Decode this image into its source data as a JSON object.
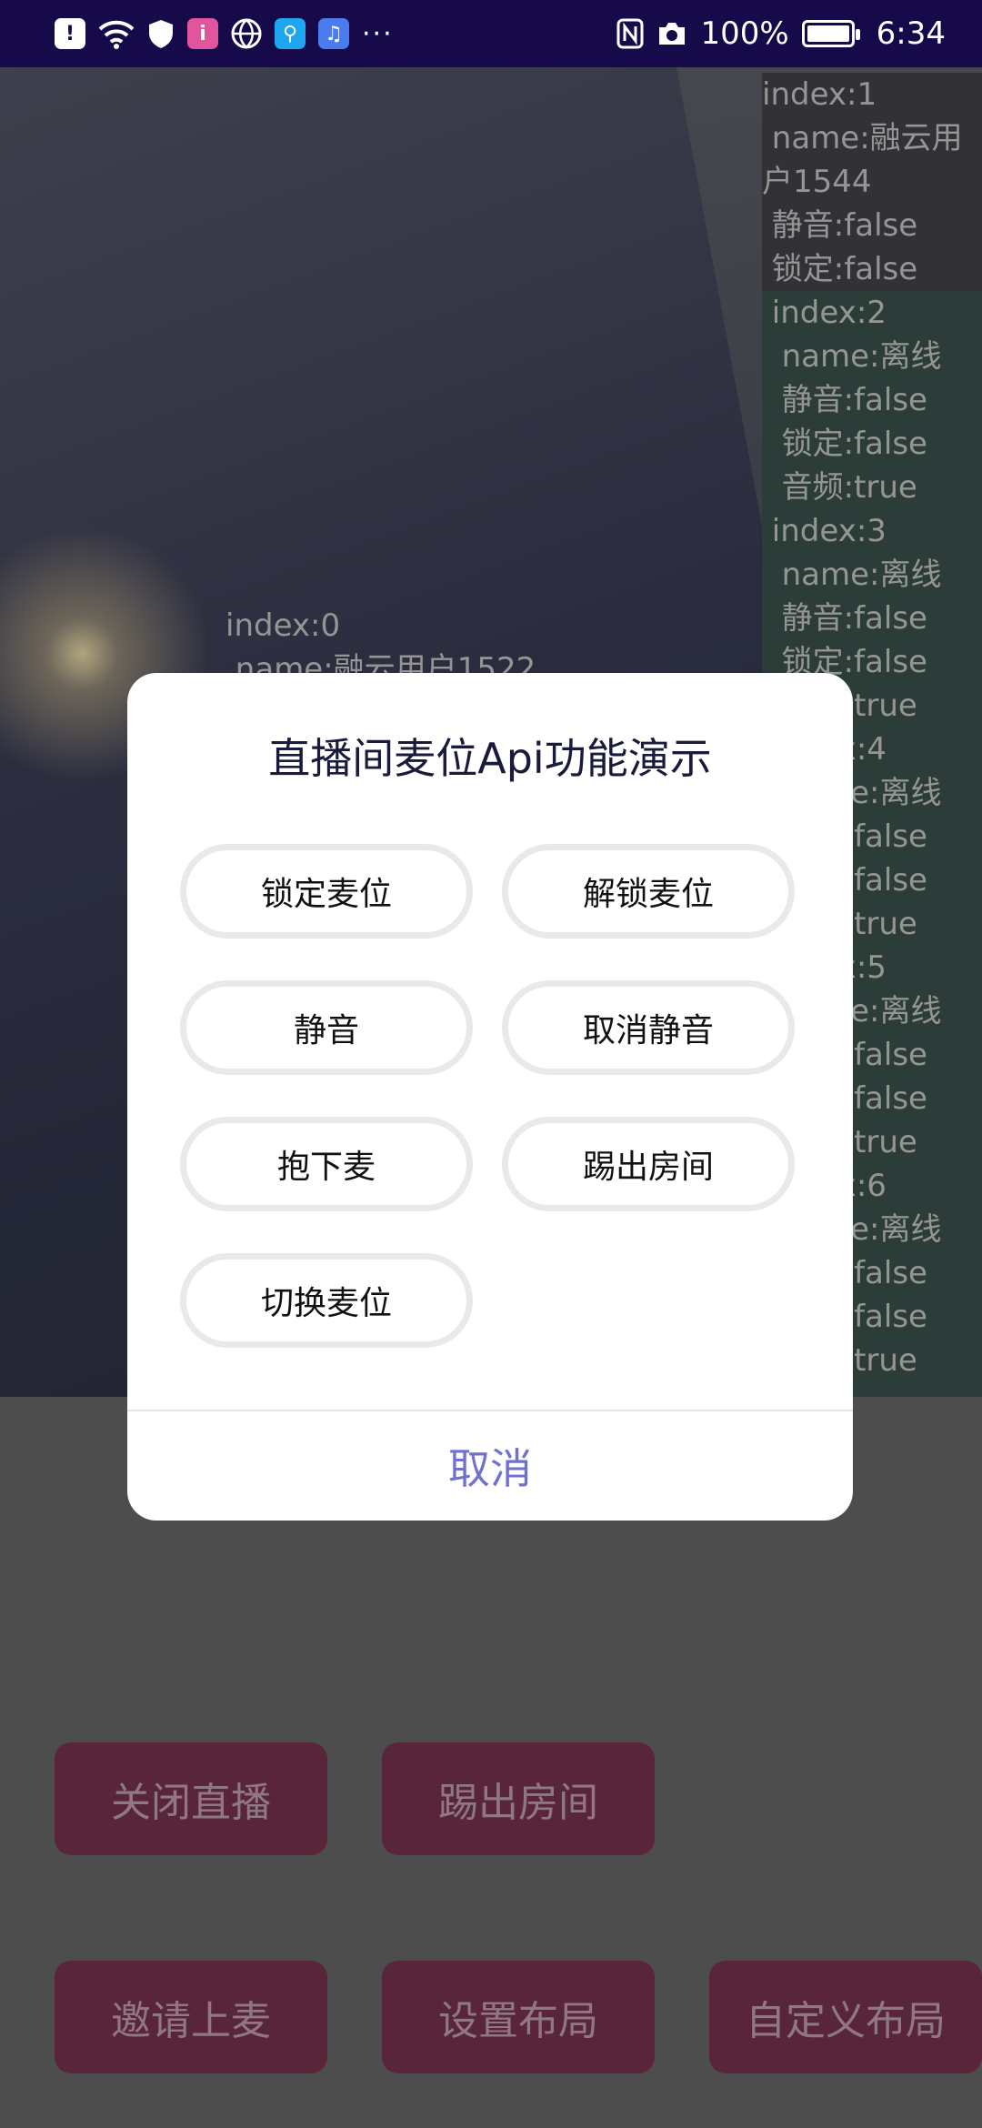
{
  "status_bar": {
    "time": "6:34",
    "battery": "100%",
    "battery_level": 1.0,
    "more": "···",
    "left_icons": [
      "alert-icon",
      "wifi-icon",
      "shield-icon",
      "app-i-icon",
      "globe-icon",
      "search-app-icon",
      "music-app-icon"
    ],
    "right_icons": [
      "nfc-icon",
      "camera-icon",
      "battery-icon"
    ]
  },
  "seats": {
    "seat_1": "index:1\n name:融云用\n户1544\n 静音:false\n 锁定:false",
    "seat_rest": " index:2\n  name:离线\n  静音:false\n  锁定:false\n  音频:true\n index:3\n  name:离线\n  静音:false\n  锁定:false\n  音频:true\n index:4\n  name:离线\n  静音:false\n  锁定:false\n  音频:true\n index:5\n  name:离线\n  静音:false\n  锁定:false\n  音频:true\n index:6\n  name:离线\n  静音:false\n  锁定:false\n  音频:true",
    "seat_0": "index:0\n name:融云用户1522"
  },
  "bottom_buttons": {
    "close_live": "关闭直播",
    "kick_out": "踢出房间",
    "invite": "邀请上麦",
    "set_layout": "设置布局",
    "custom_layout": "自定义布局"
  },
  "dialog": {
    "title": "直播间麦位Api功能演示",
    "lock_seat": "锁定麦位",
    "unlock_seat": "解锁麦位",
    "mute": "静音",
    "unmute": "取消静音",
    "kick_seat": "抱下麦",
    "kick_room": "踢出房间",
    "switch_seat": "切换麦位",
    "cancel": "取消"
  },
  "colors": {
    "status_bar": "#170a4a",
    "bottom_button": "#7a3452",
    "cancel_text": "#6f70d0"
  }
}
